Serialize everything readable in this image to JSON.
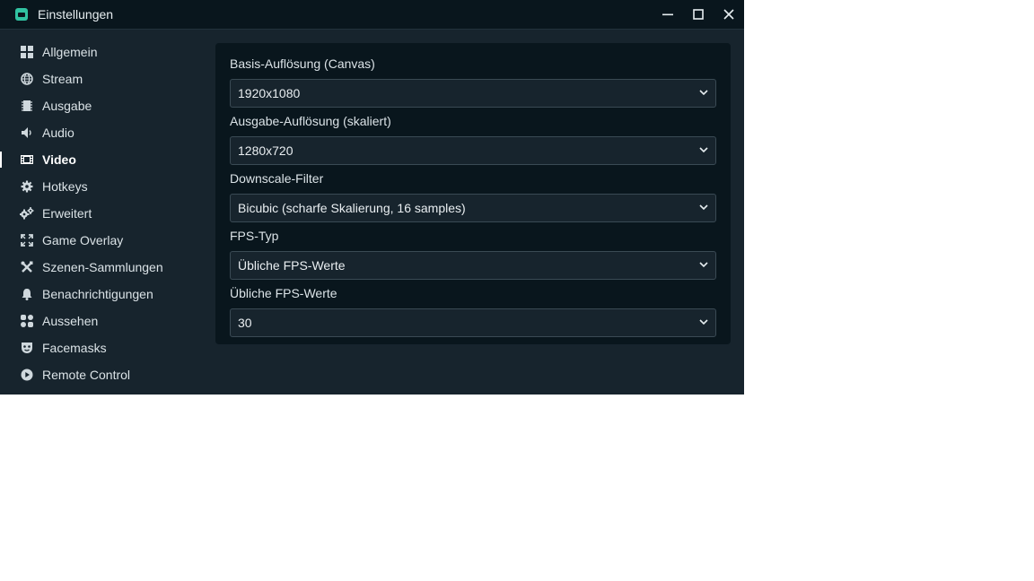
{
  "window": {
    "title": "Einstellungen",
    "controls": [
      "minimize-icon",
      "maximize-icon",
      "close-icon"
    ]
  },
  "sidebar": {
    "active": "Video",
    "items": [
      {
        "label": "Allgemein",
        "icon": "grid-icon"
      },
      {
        "label": "Stream",
        "icon": "globe-icon"
      },
      {
        "label": "Ausgabe",
        "icon": "chip-icon"
      },
      {
        "label": "Audio",
        "icon": "speaker-icon"
      },
      {
        "label": "Video",
        "icon": "film-icon"
      },
      {
        "label": "Hotkeys",
        "icon": "gear-icon"
      },
      {
        "label": "Erweitert",
        "icon": "gears-icon"
      },
      {
        "label": "Game Overlay",
        "icon": "expand-icon"
      },
      {
        "label": "Szenen-Sammlungen",
        "icon": "tools-icon"
      },
      {
        "label": "Benachrichtigungen",
        "icon": "bell-icon"
      },
      {
        "label": "Aussehen",
        "icon": "palette-icon"
      },
      {
        "label": "Facemasks",
        "icon": "mask-icon"
      },
      {
        "label": "Remote Control",
        "icon": "play-circle-icon"
      }
    ]
  },
  "video_settings": {
    "fields": [
      {
        "label": "Basis-Auflösung (Canvas)",
        "value": "1920x1080"
      },
      {
        "label": "Ausgabe-Auflösung (skaliert)",
        "value": "1280x720"
      },
      {
        "label": "Downscale-Filter",
        "value": "Bicubic (scharfe Skalierung, 16 samples)"
      },
      {
        "label": "FPS-Typ",
        "value": "Übliche FPS-Werte"
      },
      {
        "label": "Übliche FPS-Werte",
        "value": "30"
      }
    ]
  },
  "colors": {
    "window_bg": "#17242d",
    "panel_bg": "#09161d",
    "accent": "#31c3a2",
    "text": "#dbe3e7"
  }
}
